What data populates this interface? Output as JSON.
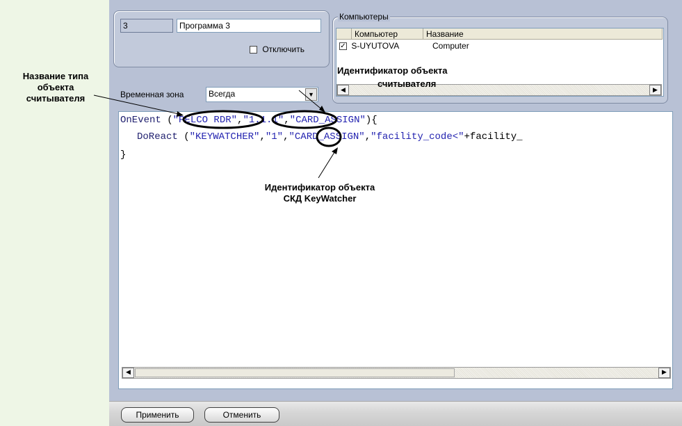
{
  "program": {
    "id": "3",
    "name": "Программа 3",
    "disable_label": "Отключить",
    "disabled": false,
    "time_zone_label": "Временная зона",
    "time_zone_value": "Всегда"
  },
  "computers": {
    "legend": "Компьютеры",
    "columns": [
      "Компьютер",
      "Название"
    ],
    "rows": [
      {
        "checked": true,
        "computer": "S-UYUTOVA",
        "name": "Computer"
      }
    ]
  },
  "script": {
    "line1": {
      "func": "OnEvent",
      "open": " (",
      "a1": "\"PELCO RDR\"",
      "sep1": ",",
      "a2": "\"1.1.1\"",
      "sep2": ",",
      "a3": "\"CARD_ASSIGN\"",
      "close": "){"
    },
    "line2": {
      "func": "DoReact",
      "open": " (",
      "a1": "\"KEYWATCHER\"",
      "sep1": ",",
      "a2": "\"1\"",
      "sep2": ",",
      "a3": "\"CARD_ASSIGN\"",
      "sep3": ",",
      "a4": "\"facility_code<\"",
      "rest": "+facility_"
    },
    "line3": "}"
  },
  "callouts": {
    "reader_type_line1": "Название типа",
    "reader_type_line2": "объекта",
    "reader_type_line3": "считывателя",
    "reader_id_line1": "Идентификатор объекта",
    "reader_id_line2": "считывателя",
    "keywatcher_id_line1": "Идентификатор объекта",
    "keywatcher_id_line2": "СКД KeyWatcher"
  },
  "buttons": {
    "apply": "Применить",
    "cancel": "Отменить"
  }
}
